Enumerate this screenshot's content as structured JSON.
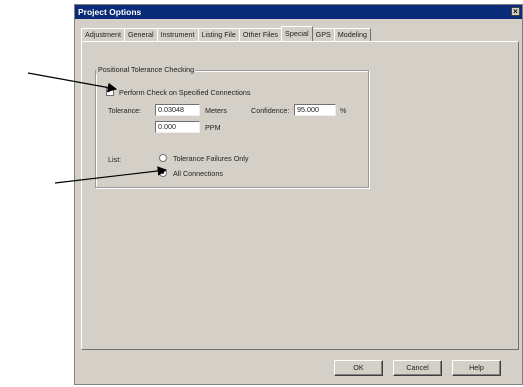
{
  "window": {
    "title": "Project Options",
    "close_glyph": "×"
  },
  "tabs": [
    {
      "label": "Adjustment",
      "active": false
    },
    {
      "label": "General",
      "active": false
    },
    {
      "label": "Instrument",
      "active": false
    },
    {
      "label": "Listing File",
      "active": false
    },
    {
      "label": "Other Files",
      "active": false
    },
    {
      "label": "Special",
      "active": true
    },
    {
      "label": "GPS",
      "active": false
    },
    {
      "label": "Modeling",
      "active": false
    }
  ],
  "group": {
    "legend": "Positional Tolerance Checking",
    "check_label": "Perform Check on Specified Connections",
    "check_checked": true,
    "tolerance_label": "Tolerance:",
    "tolerance_value": "0.03048",
    "tolerance_unit": "Meters",
    "confidence_label": "Confidence:",
    "confidence_value": "95.000",
    "confidence_unit": "%",
    "ppm_value": "0.000",
    "ppm_unit": "PPM",
    "list_label": "List:",
    "radio1_label": "Tolerance Failures Only",
    "radio2_label": "All Connections",
    "selected_radio": "All Connections"
  },
  "buttons": {
    "ok": "OK",
    "cancel": "Cancel",
    "help": "Help"
  },
  "colors": {
    "titlebar": "#0a2b78",
    "face": "#d4d0c8"
  }
}
